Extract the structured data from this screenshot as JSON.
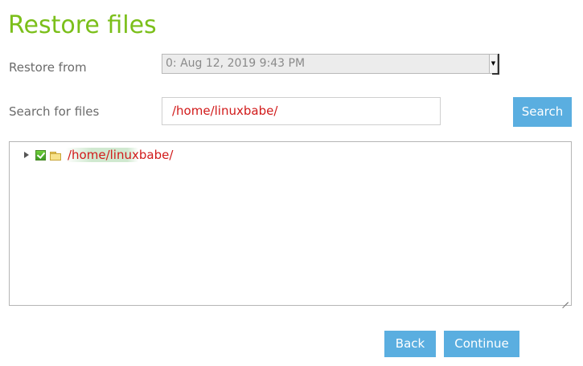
{
  "page": {
    "title": "Restore files"
  },
  "restore_from": {
    "label": "Restore from",
    "selected_value": "0: Aug 12, 2019 9:43 PM"
  },
  "search": {
    "label": "Search for files",
    "value": "/home/linuxbabe/",
    "button_label": "Search"
  },
  "tree": {
    "nodes": [
      {
        "label": "/home/linuxbabe/",
        "checked": true,
        "expanded": false,
        "icon": "folder-icon"
      }
    ]
  },
  "actions": {
    "back_label": "Back",
    "continue_label": "Continue"
  },
  "colors": {
    "title": "#7bbf1a",
    "button": "#5aaee0",
    "path_text": "#d11a1a"
  }
}
